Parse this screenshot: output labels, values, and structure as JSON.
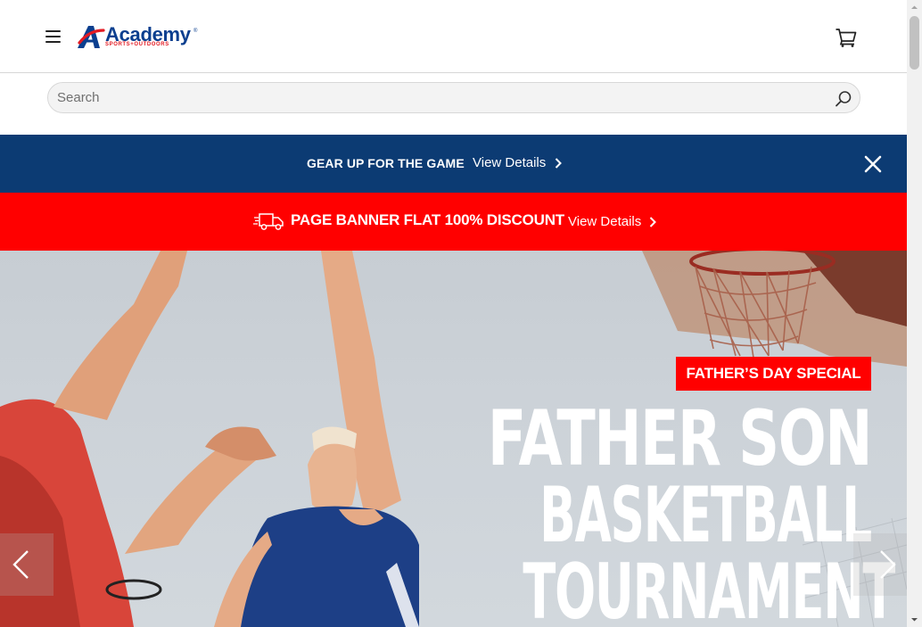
{
  "header": {
    "menu_icon": "hamburger-menu-icon",
    "logo": {
      "word": "Academy",
      "sub": "SPORTS+OUTDOORS",
      "registered": "®",
      "primary_color": "#0b3f8f",
      "accent_color": "#e31b23"
    },
    "cart_icon": "shopping-cart-icon"
  },
  "search": {
    "placeholder": "Search",
    "value": "",
    "icon": "search-icon"
  },
  "promo_banner": {
    "background": "#0c3b73",
    "title": "GEAR UP FOR THE GAME",
    "link": "View Details",
    "close_icon": "close-icon"
  },
  "discount_banner": {
    "background": "#ff0000",
    "icon": "delivery-truck-icon",
    "title": "PAGE BANNER FLAT 100% DISCOUNT",
    "link": "View Details"
  },
  "hero": {
    "badge": "FATHER’S DAY SPECIAL",
    "headline_lines": [
      "FATHER SON",
      "BASKETBALL",
      "TOURNAMENT"
    ],
    "prev_icon": "chevron-left-icon",
    "next_icon": "chevron-right-icon"
  }
}
